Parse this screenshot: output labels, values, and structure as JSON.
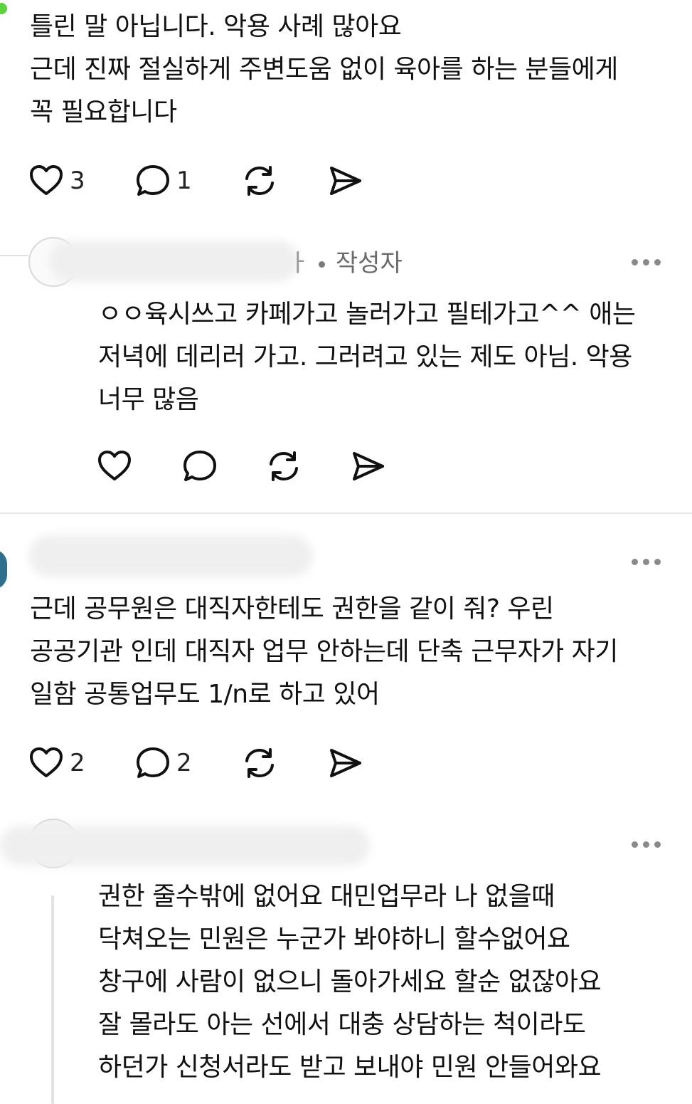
{
  "comments": [
    {
      "lines": [
        "틀린 말 아닙니다. 악용 사례 많아요",
        "근데 진짜 절실하게 주변도움 없이 육아를 하는 분들에게",
        "꼭 필요합니다"
      ],
      "likes": "3",
      "replies": "1"
    },
    {
      "author_badge": "작성자",
      "author_tail": "ㅏ",
      "lines": [
        "ㅇㅇ육시쓰고 카페가고 놀러가고 필테가고^^ 애는",
        "저녁에 데리러 가고. 그러려고 있는 제도 아님. 악용",
        "너무 많음"
      ]
    },
    {
      "lines": [
        "근데 공무원은 대직자한테도 권한을 같이 줘? 우린",
        "공공기관 인데 대직자 업무 안하는데 단축 근무자가 자기",
        "일함 공통업무도 1/n로 하고 있어"
      ],
      "likes": "2",
      "replies": "2"
    },
    {
      "lines": [
        "권한 줄수밖에 없어요 대민업무라 나 없을때",
        "닥쳐오는 민원은 누군가 봐야하니 할수없어요",
        "창구에 사람이 없으니 돌아가세요 할순 없잖아요",
        "잘 몰라도 아는 선에서 대충 상담하는 척이라도",
        "하던가 신청서라도 받고 보내야 민원 안들어와요"
      ]
    }
  ],
  "icons": {
    "like": "heart-icon",
    "comment": "speech-bubble-icon",
    "repost": "repost-icon",
    "share": "send-icon",
    "more": "more-dots-icon"
  },
  "colors": {
    "online_dot": "#5ad33c",
    "muted": "#8a8a8a",
    "text": "#111111"
  }
}
